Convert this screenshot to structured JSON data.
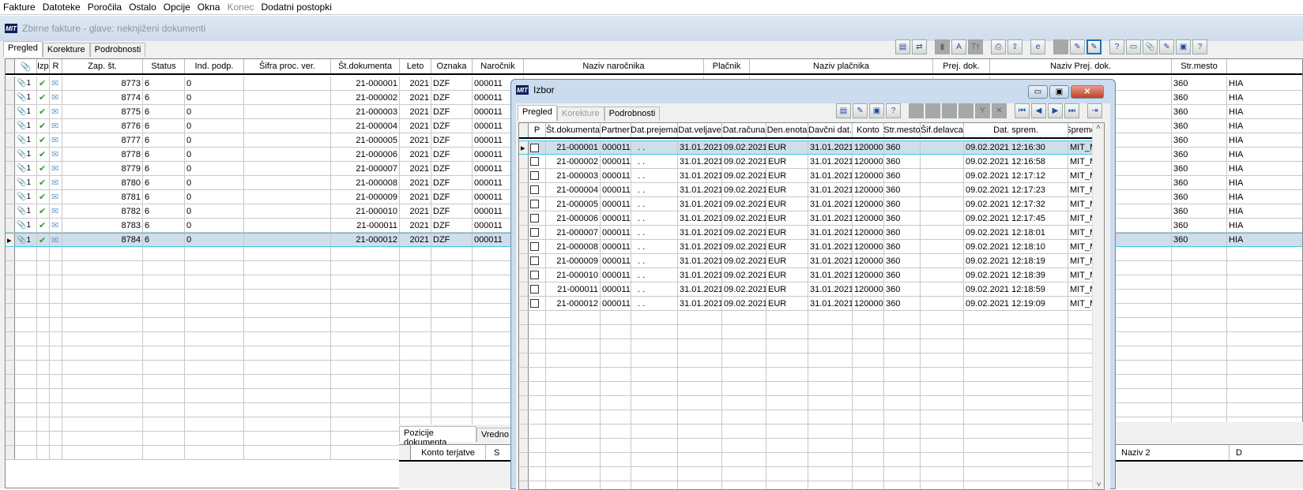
{
  "menu": [
    "Fakture",
    "Datoteke",
    "Poročila",
    "Ostalo",
    "Opcije",
    "Okna",
    "Konec",
    "Dodatni postopki"
  ],
  "menu_disabled": [
    "Konec"
  ],
  "child_window": {
    "logo": "MIT",
    "title": "Zbirne fakture - glave: neknjiženi dokumenti"
  },
  "main": {
    "tabs": [
      "Pregled",
      "Korekture",
      "Podrobnosti"
    ],
    "toolbar_icons": [
      "report-icon",
      "refresh-icon",
      "doc-gray-icon",
      "font-a-icon",
      "font-tt-icon",
      "pdf-icon",
      "export-icon",
      "ie-icon",
      "blank-icon",
      "edit-green-icon",
      "edit-active-icon",
      "help-doc-icon",
      "window-icon",
      "paperclip-icon",
      "pencil-icon",
      "card-icon",
      "help-icon"
    ],
    "columns": [
      "",
      "Izp.",
      "R",
      "Zap. št.",
      "Status",
      "Ind. podp.",
      "Šifra proc. ver.",
      "Št.dokumenta",
      "Leto",
      "Oznaka",
      "Naročnik",
      "Naziv naročnika",
      "Plačnik",
      "Naziv plačnika",
      "Prej. dok.",
      "Naziv Prej. dok.",
      "Str.mesto",
      ""
    ],
    "rows": [
      {
        "att": "1",
        "zap": "8773",
        "status": "6",
        "ind": "0",
        "stdok": "21-000001",
        "leto": "2021",
        "oznaka": "DZF",
        "narocnik": "000011",
        "strm": "360",
        "last": "HIA"
      },
      {
        "att": "1",
        "zap": "8774",
        "status": "6",
        "ind": "0",
        "stdok": "21-000002",
        "leto": "2021",
        "oznaka": "DZF",
        "narocnik": "000011",
        "strm": "360",
        "last": "HIA"
      },
      {
        "att": "1",
        "zap": "8775",
        "status": "6",
        "ind": "0",
        "stdok": "21-000003",
        "leto": "2021",
        "oznaka": "DZF",
        "narocnik": "000011",
        "strm": "360",
        "last": "HIA"
      },
      {
        "att": "1",
        "zap": "8776",
        "status": "6",
        "ind": "0",
        "stdok": "21-000004",
        "leto": "2021",
        "oznaka": "DZF",
        "narocnik": "000011",
        "strm": "360",
        "last": "HIA"
      },
      {
        "att": "1",
        "zap": "8777",
        "status": "6",
        "ind": "0",
        "stdok": "21-000005",
        "leto": "2021",
        "oznaka": "DZF",
        "narocnik": "000011",
        "strm": "360",
        "last": "HIA"
      },
      {
        "att": "1",
        "zap": "8778",
        "status": "6",
        "ind": "0",
        "stdok": "21-000006",
        "leto": "2021",
        "oznaka": "DZF",
        "narocnik": "000011",
        "strm": "360",
        "last": "HIA"
      },
      {
        "att": "1",
        "zap": "8779",
        "status": "6",
        "ind": "0",
        "stdok": "21-000007",
        "leto": "2021",
        "oznaka": "DZF",
        "narocnik": "000011",
        "strm": "360",
        "last": "HIA"
      },
      {
        "att": "1",
        "zap": "8780",
        "status": "6",
        "ind": "0",
        "stdok": "21-000008",
        "leto": "2021",
        "oznaka": "DZF",
        "narocnik": "000011",
        "strm": "360",
        "last": "HIA"
      },
      {
        "att": "1",
        "zap": "8781",
        "status": "6",
        "ind": "0",
        "stdok": "21-000009",
        "leto": "2021",
        "oznaka": "DZF",
        "narocnik": "000011",
        "strm": "360",
        "last": "HIA"
      },
      {
        "att": "1",
        "zap": "8782",
        "status": "6",
        "ind": "0",
        "stdok": "21-000010",
        "leto": "2021",
        "oznaka": "DZF",
        "narocnik": "000011",
        "strm": "360",
        "last": "HIA"
      },
      {
        "att": "1",
        "zap": "8783",
        "status": "6",
        "ind": "0",
        "stdok": "21-000011",
        "leto": "2021",
        "oznaka": "DZF",
        "narocnik": "000011",
        "strm": "360",
        "last": "HIA"
      },
      {
        "att": "1",
        "zap": "8784",
        "status": "6",
        "ind": "0",
        "stdok": "21-000012",
        "leto": "2021",
        "oznaka": "DZF",
        "narocnik": "000011",
        "strm": "360",
        "last": "HIA"
      }
    ],
    "selected_row": 11,
    "bottom": {
      "tabs": [
        "Pozicije dokumenta",
        "Vredno"
      ],
      "columns": [
        "Konto terjatve",
        "S"
      ],
      "right_columns": [
        "Naziv 2",
        "D"
      ]
    }
  },
  "dialog": {
    "logo": "MIT",
    "title": "Izbor",
    "tabs": [
      "Pregled",
      "Korekture",
      "Podrobnosti"
    ],
    "toolbar_icons": [
      "report-icon",
      "edit-icon",
      "card-icon",
      "help-icon",
      "new-icon",
      "edit-doc-icon",
      "delete-icon",
      "search-icon",
      "filter-icon",
      "clear-filter-icon",
      "first-icon",
      "prev-icon",
      "next-icon",
      "last-icon",
      "exit-icon"
    ],
    "columns": [
      "",
      "P",
      "Št.dokumenta",
      "Partner",
      "Dat.prejema",
      "Dat.veljave",
      "Dat.računa",
      "Den.enota",
      "Davčni dat.",
      "Konto",
      "Str.mesto",
      "Šif.delavca",
      "Dat. sprem.",
      "Spreme"
    ],
    "rows": [
      {
        "stdok": "21-000001",
        "partner": "000011",
        "prejema": ". .",
        "veljave": "31.01.2021",
        "racuna": "09.02.2021",
        "enota": "EUR",
        "davcni": "31.01.2021",
        "konto": "120000",
        "strm": "360",
        "sif": "",
        "sprem": "09.02.2021 12:16:30",
        "spreme": "MIT_M"
      },
      {
        "stdok": "21-000002",
        "partner": "000011",
        "prejema": ". .",
        "veljave": "31.01.2021",
        "racuna": "09.02.2021",
        "enota": "EUR",
        "davcni": "31.01.2021",
        "konto": "120000",
        "strm": "360",
        "sif": "",
        "sprem": "09.02.2021 12:16:58",
        "spreme": "MIT_M"
      },
      {
        "stdok": "21-000003",
        "partner": "000011",
        "prejema": ". .",
        "veljave": "31.01.2021",
        "racuna": "09.02.2021",
        "enota": "EUR",
        "davcni": "31.01.2021",
        "konto": "120000",
        "strm": "360",
        "sif": "",
        "sprem": "09.02.2021 12:17:12",
        "spreme": "MIT_M"
      },
      {
        "stdok": "21-000004",
        "partner": "000011",
        "prejema": ". .",
        "veljave": "31.01.2021",
        "racuna": "09.02.2021",
        "enota": "EUR",
        "davcni": "31.01.2021",
        "konto": "120000",
        "strm": "360",
        "sif": "",
        "sprem": "09.02.2021 12:17:23",
        "spreme": "MIT_M"
      },
      {
        "stdok": "21-000005",
        "partner": "000011",
        "prejema": ". .",
        "veljave": "31.01.2021",
        "racuna": "09.02.2021",
        "enota": "EUR",
        "davcni": "31.01.2021",
        "konto": "120000",
        "strm": "360",
        "sif": "",
        "sprem": "09.02.2021 12:17:32",
        "spreme": "MIT_M"
      },
      {
        "stdok": "21-000006",
        "partner": "000011",
        "prejema": ". .",
        "veljave": "31.01.2021",
        "racuna": "09.02.2021",
        "enota": "EUR",
        "davcni": "31.01.2021",
        "konto": "120000",
        "strm": "360",
        "sif": "",
        "sprem": "09.02.2021 12:17:45",
        "spreme": "MIT_M"
      },
      {
        "stdok": "21-000007",
        "partner": "000011",
        "prejema": ". .",
        "veljave": "31.01.2021",
        "racuna": "09.02.2021",
        "enota": "EUR",
        "davcni": "31.01.2021",
        "konto": "120000",
        "strm": "360",
        "sif": "",
        "sprem": "09.02.2021 12:18:01",
        "spreme": "MIT_M"
      },
      {
        "stdok": "21-000008",
        "partner": "000011",
        "prejema": ". .",
        "veljave": "31.01.2021",
        "racuna": "09.02.2021",
        "enota": "EUR",
        "davcni": "31.01.2021",
        "konto": "120000",
        "strm": "360",
        "sif": "",
        "sprem": "09.02.2021 12:18:10",
        "spreme": "MIT_M"
      },
      {
        "stdok": "21-000009",
        "partner": "000011",
        "prejema": ". .",
        "veljave": "31.01.2021",
        "racuna": "09.02.2021",
        "enota": "EUR",
        "davcni": "31.01.2021",
        "konto": "120000",
        "strm": "360",
        "sif": "",
        "sprem": "09.02.2021 12:18:19",
        "spreme": "MIT_M"
      },
      {
        "stdok": "21-000010",
        "partner": "000011",
        "prejema": ". .",
        "veljave": "31.01.2021",
        "racuna": "09.02.2021",
        "enota": "EUR",
        "davcni": "31.01.2021",
        "konto": "120000",
        "strm": "360",
        "sif": "",
        "sprem": "09.02.2021 12:18:39",
        "spreme": "MIT_M"
      },
      {
        "stdok": "21-000011",
        "partner": "000011",
        "prejema": ". .",
        "veljave": "31.01.2021",
        "racuna": "09.02.2021",
        "enota": "EUR",
        "davcni": "31.01.2021",
        "konto": "120000",
        "strm": "360",
        "sif": "",
        "sprem": "09.02.2021 12:18:59",
        "spreme": "MIT_M"
      },
      {
        "stdok": "21-000012",
        "partner": "000011",
        "prejema": ". .",
        "veljave": "31.01.2021",
        "racuna": "09.02.2021",
        "enota": "EUR",
        "davcni": "31.01.2021",
        "konto": "120000",
        "strm": "360",
        "sif": "",
        "sprem": "09.02.2021 12:19:09",
        "spreme": "MIT_M"
      }
    ],
    "selected_row": 0
  },
  "colors": {
    "selection": "#cfdeeb",
    "selection_border": "#3cc8e0",
    "title_bar": "#cbdcee",
    "close": "#c0412b",
    "check": "#2e9e2e"
  }
}
